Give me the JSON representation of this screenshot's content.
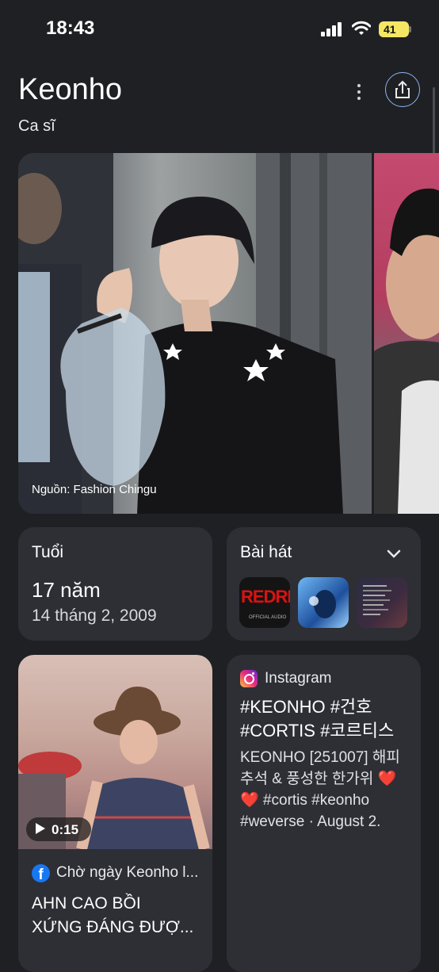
{
  "status_bar": {
    "time": "18:43",
    "battery": "41"
  },
  "header": {
    "title": "Keonho",
    "subtitle": "Ca sĩ"
  },
  "gallery": {
    "credit": "Nguồn: Fashion Chingu"
  },
  "age_card": {
    "title": "Tuổi",
    "value": "17 năm",
    "birthdate": "14 tháng 2, 2009"
  },
  "songs_card": {
    "title": "Bài hát",
    "thumb1_text": "REDRE",
    "thumb1_caption": "OFFICIAL AUDIO"
  },
  "video_card": {
    "duration": "0:15",
    "source": "Chờ ngày Keonho l...",
    "title_line1": "AHN CAO BỒI",
    "title_line2": "XỨNG ĐÁNG ĐƯỢ..."
  },
  "instagram_card": {
    "source": "Instagram",
    "title_line1": "#KEONHO #건호",
    "title_line2": "#CORTIS #코르티스",
    "body_line1": "KEONHO [251007] 해피",
    "body_line2": "추석 & 풍성한 한가위 ❤️",
    "body_line3": "❤️ #cortis #keonho",
    "body_line4": "#weverse · August 2."
  },
  "colors": {
    "background": "#1f2024",
    "card": "#2d2f35",
    "accent": "#8ab4f8"
  }
}
